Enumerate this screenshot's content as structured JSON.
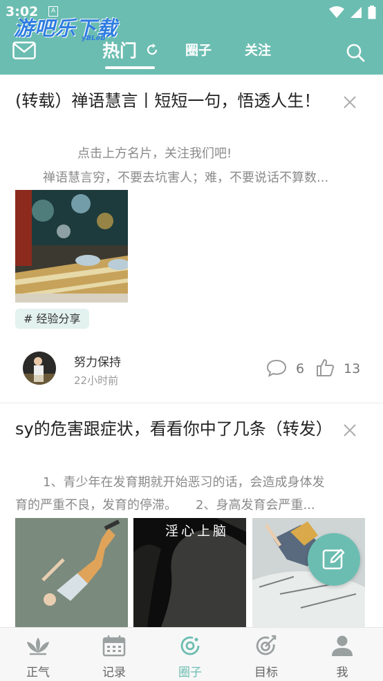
{
  "status_bar": {
    "time": "3:02",
    "indicator": "A"
  },
  "watermark": {
    "text": "游吧乐下载",
    "sub": "yBLeb"
  },
  "header": {
    "tabs": [
      {
        "label": "热门",
        "active": true
      },
      {
        "label": "圈子",
        "active": false
      },
      {
        "label": "关注",
        "active": false
      }
    ],
    "left_icon": "mail-icon",
    "right_icon": "search-icon",
    "accent_color": "#6cbdb1"
  },
  "posts": [
    {
      "title": "(转载）禅语慧言丨短短一句，悟透人生！",
      "excerpt_line1": "点击上方名片，关注我们吧!",
      "excerpt_line2": "禅语慧言穷，不要去坑害人；难，不要说话不算数...",
      "tag": "# 经验分享",
      "author": "努力保持",
      "time": "22小时前",
      "comments": "6",
      "likes": "13"
    },
    {
      "title": "sy的危害跟症状，看看你中了几条（转发）",
      "excerpt_line1": "1、青少年在发育期就开始恶习的话，会造成身体发",
      "excerpt_line2": "育的严重不良，发育的停滞。　　2、身高发育会严重...",
      "image_caption": "淫心上脑"
    }
  ],
  "bottom_nav": [
    {
      "label": "正气",
      "icon": "lotus-icon",
      "active": false
    },
    {
      "label": "记录",
      "icon": "calendar-icon",
      "active": false
    },
    {
      "label": "圈子",
      "icon": "circle-icon",
      "active": true
    },
    {
      "label": "目标",
      "icon": "target-icon",
      "active": false
    },
    {
      "label": "我",
      "icon": "person-icon",
      "active": false
    }
  ]
}
